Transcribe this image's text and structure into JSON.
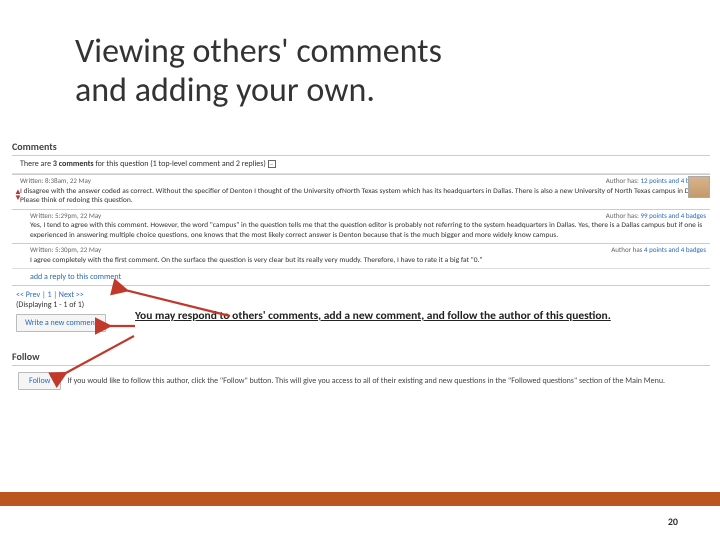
{
  "title_line1": "Viewing others' comments",
  "title_line2": "and adding your own.",
  "comments": {
    "header": "Comments",
    "count_prefix": "There are ",
    "count_bold": "3 comments",
    "count_suffix": " for this question (1 top-level comment and 2 replies) ",
    "toggle": "–",
    "items": [
      {
        "meta_left": "Written: 8:38am, 22 May",
        "meta_right_prefix": "Author has: ",
        "meta_right_num": "12 points and 4 badges",
        "body": "I disagree with the answer coded as correct.  Without the specifier of Denton I thought of the University ofNorth Texas system which has its headquarters in Dallas.  There is also a new University of North Texas campus in Dallas.  Please think of redoing this question."
      },
      {
        "meta_left": "Written: 5:29pm, 22 May",
        "meta_right_prefix": "Author has: ",
        "meta_right_num": "99 points and 4 badges",
        "body": "Yes, I tend to agree with this comment.  However, the word \"campus\" in the question tells me that the question editor is probably not referring to the system headquarters in Dallas.  Yes, there is a Dallas campus but if one is experienced in answering multiple choice questions, one knows that the most likely correct answer is Denton because that is the much bigger and more widely know campus."
      },
      {
        "meta_left": "Written: 5:30pm, 22 May",
        "meta_right_prefix": "Author has ",
        "meta_right_num": "4 points and 4 badges",
        "body": "I agree completely with the first comment. On the surface the question is very clear but its really very muddy.  Therefore, I have to rate it a big fat \"0.\""
      }
    ],
    "reply_link": "add a reply to this comment",
    "pager_nav": "<< Prev | 1 | Next >>",
    "pager_display": "(Displaying 1 - 1 of 1)",
    "write_btn": "Write a new comment"
  },
  "follow": {
    "header": "Follow",
    "btn": "Follow",
    "text": "If you would like to follow this author, click the \"Follow\" button. This will give you access to all of their existing and new questions in the \"Followed questions\" section of the Main Menu."
  },
  "callout": "You may respond to others' comments, add a new comment, and follow the author of this question.",
  "page_num": "20"
}
